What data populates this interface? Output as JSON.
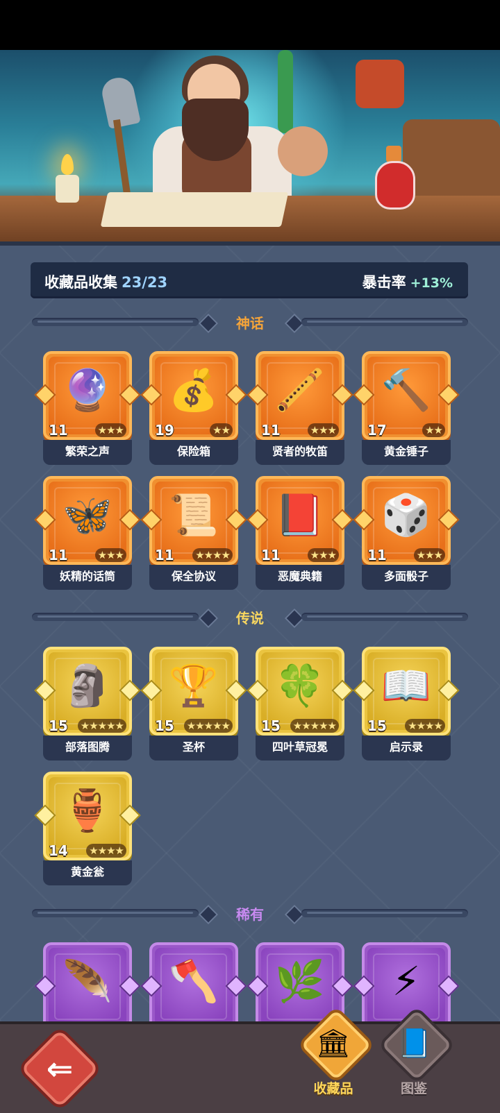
{
  "colors": {
    "mythic": "#f09030",
    "legendary": "#eac440",
    "rare": "#9a58c8",
    "background": "#4a5a74",
    "mythic_title": "#f5a43a",
    "legendary_title": "#f7d660",
    "rare_title": "#c88af0"
  },
  "stats": {
    "label": "收藏品收集",
    "count": "23/23",
    "bonus_label": "暴击率",
    "bonus_value": "+13%"
  },
  "sections": {
    "mythic": {
      "title": "神话"
    },
    "legendary": {
      "title": "传说"
    },
    "rare": {
      "title": "稀有"
    }
  },
  "items": {
    "mythic": [
      {
        "name": "繁荣之声",
        "level": "11",
        "stars": "★★★",
        "icon": "blue-spirit-icon"
      },
      {
        "name": "保险箱",
        "level": "19",
        "stars": "★★",
        "icon": "treasure-chest-icon"
      },
      {
        "name": "贤者的牧笛",
        "level": "11",
        "stars": "★★★",
        "icon": "flute-icon"
      },
      {
        "name": "黄金锤子",
        "level": "17",
        "stars": "★★",
        "icon": "hammer-icon"
      },
      {
        "name": "妖精的话筒",
        "level": "11",
        "stars": "★★★",
        "icon": "fairy-microphone-icon"
      },
      {
        "name": "保全协议",
        "level": "11",
        "stars": "★★★★",
        "icon": "contract-scroll-icon"
      },
      {
        "name": "恶魔典籍",
        "level": "11",
        "stars": "★★★",
        "icon": "demon-book-icon"
      },
      {
        "name": "多面骰子",
        "level": "11",
        "stars": "★★★",
        "icon": "dice-icon"
      }
    ],
    "legendary": [
      {
        "name": "部落图腾",
        "level": "15",
        "stars": "★★★★★",
        "icon": "totem-icon"
      },
      {
        "name": "圣杯",
        "level": "15",
        "stars": "★★★★★",
        "icon": "chalice-icon"
      },
      {
        "name": "四叶草冠冕",
        "level": "15",
        "stars": "★★★★★",
        "icon": "clover-crown-icon"
      },
      {
        "name": "启示录",
        "level": "15",
        "stars": "★★★★",
        "icon": "open-book-icon"
      },
      {
        "name": "黄金瓮",
        "level": "14",
        "stars": "★★★★",
        "icon": "golden-urn-icon"
      }
    ],
    "rare": [
      {
        "icon": "feather-icon"
      },
      {
        "icon": "axe-icon"
      },
      {
        "icon": "vine-icon"
      },
      {
        "icon": "lightning-card-icon"
      }
    ]
  },
  "glyphs": {
    "mythic": [
      "🔮",
      "💰",
      "🪈",
      "🔨",
      "🦋",
      "📜",
      "📕",
      "🎲"
    ],
    "legendary": [
      "🗿",
      "🏆",
      "🍀",
      "📖",
      "🏺"
    ],
    "rare": [
      "🪶",
      "🪓",
      "🌿",
      "⚡"
    ]
  },
  "nav": {
    "back_arrow": "⇐",
    "collection_label": "收藏品",
    "collection_icon": "🏛",
    "encyclopedia_label": "图鉴",
    "encyclopedia_icon": "📘"
  }
}
